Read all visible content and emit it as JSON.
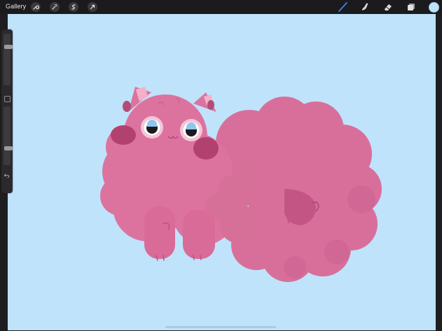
{
  "topbar": {
    "gallery_label": "Gallery",
    "left_tools": [
      "wrench-icon",
      "magic-wand-icon",
      "selection-icon",
      "transform-arrow-icon"
    ],
    "right_tools": [
      "brush-icon",
      "smudge-icon",
      "eraser-icon",
      "layers-icon"
    ],
    "active_tool": "brush-icon",
    "active_color": "#bfe2fb"
  },
  "canvas": {
    "background_color": "#bfe3fb",
    "subject": "pink-fluffy-cat-drawing"
  },
  "sidebar": {
    "brush_size": 0.76,
    "opacity": 0.27,
    "modify_icon": "square-icon",
    "undo_icon": "undo-arrow-icon"
  }
}
